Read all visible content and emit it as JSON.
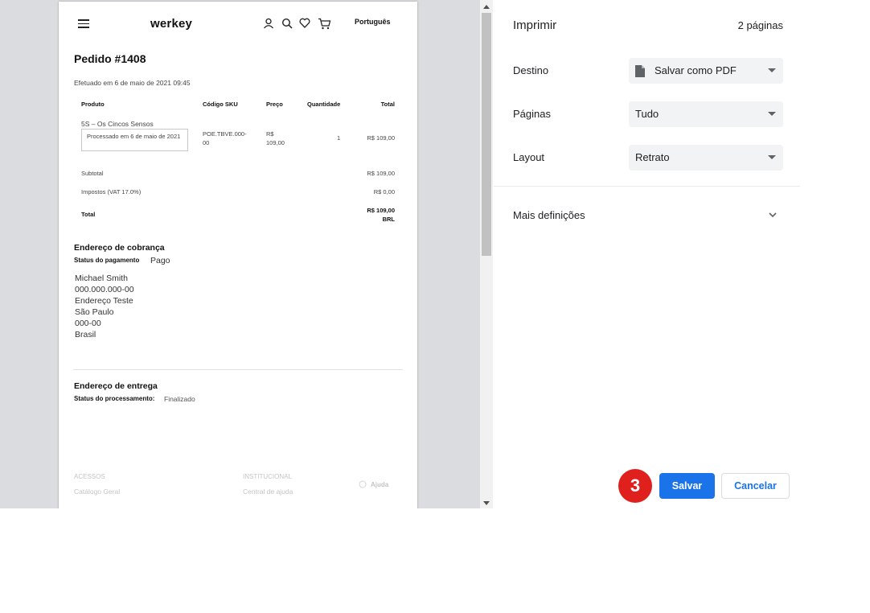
{
  "preview": {
    "header": {
      "brand": "werkey",
      "language": "Português",
      "icons": [
        "menu-icon",
        "user-icon",
        "search-icon",
        "heart-icon",
        "cart-icon"
      ]
    },
    "order": {
      "title": "Pedido #1408",
      "date": "Efetuado em 6 de maio de 2021 09:45"
    },
    "table": {
      "headers": [
        "Produto",
        "Código SKU",
        "Preço",
        "Quantidade",
        "Total"
      ],
      "row": {
        "product": "5S – Os Cincos Sensos",
        "processed": "Processado em 6 de maio de 2021",
        "sku_line1": "POE.TBVE.000-",
        "sku_line2": "00",
        "price_line1": "R$",
        "price_line2": "109,00",
        "quantity": "1",
        "total": "R$ 109,00"
      }
    },
    "summary": {
      "subtotal_label": "Subtotal",
      "subtotal_value": "R$ 109,00",
      "tax_label": "Impostos (VAT 17.0%)",
      "tax_value": "R$ 0,00",
      "total_label": "Total",
      "total_value_line1": "R$ 109,00",
      "total_value_line2": "BRL"
    },
    "billing": {
      "title": "Endereço de cobrança",
      "payment_status_label": "Status do pagamento",
      "payment_status_value": "Pago",
      "lines": [
        "Michael Smith",
        "000.000.000-00",
        "Endereço Teste",
        "São Paulo",
        "000-00",
        "Brasil"
      ]
    },
    "shipping": {
      "title": "Endereço de entrega",
      "processing_status_label": "Status do processamento:",
      "processing_status_value": "Finalizado"
    },
    "footer": {
      "col1_title": "ACESSOS",
      "col1_item": "Catálogo Geral",
      "col2_title": "INSTITUCIONAL",
      "col2_item": "Central de ajuda",
      "help": "Ajuda"
    }
  },
  "print": {
    "title": "Imprimir",
    "page_count": "2 páginas",
    "destination_label": "Destino",
    "destination_value": "Salvar como PDF",
    "pages_label": "Páginas",
    "pages_value": "Tudo",
    "layout_label": "Layout",
    "layout_value": "Retrato",
    "more_settings": "Mais definições",
    "save_label": "Salvar",
    "cancel_label": "Cancelar"
  },
  "step_badge": "3",
  "colors": {
    "primary": "#1a73e8",
    "badge": "#e0201d",
    "preview_bg": "#dadce0"
  }
}
